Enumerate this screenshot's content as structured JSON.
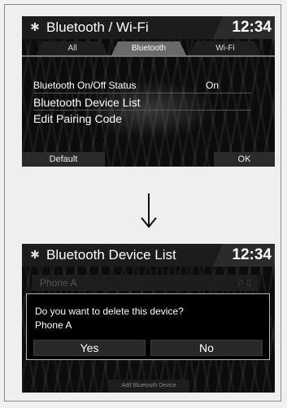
{
  "screen1": {
    "title": "Bluetooth / Wi-Fi",
    "clock": "12:34",
    "title_icon": "settings-gear-icon",
    "tabs": [
      {
        "label": "All",
        "active": false
      },
      {
        "label": "Bluetooth",
        "active": true
      },
      {
        "label": "Wi-Fi",
        "active": false
      }
    ],
    "rows": [
      {
        "label": "Bluetooth On/Off Status",
        "value": "On"
      },
      {
        "label": "Bluetooth Device List",
        "value": ""
      },
      {
        "label": "Edit Pairing Code",
        "value": ""
      }
    ],
    "default_label": "Default",
    "ok_label": "OK"
  },
  "arrow_icon": "arrow-down-icon",
  "screen2": {
    "title": "Bluetooth Device List",
    "clock": "12:34",
    "title_icon": "settings-gear-icon",
    "device_row": "Phone A",
    "device_icons": "music-note-icon, phone-icon",
    "dialog": {
      "message": "Do you want to delete this device?",
      "device": "Phone A",
      "yes_label": "Yes",
      "no_label": "No"
    },
    "add_label": "Add Bluetooth Device"
  },
  "colors": {
    "screen_bg": "#0c0c0c",
    "titlebar_bg": "#1c1c1c",
    "active_tab": "#6a6a6a",
    "dialog_border": "#b5b5b5",
    "page_bg": "#efefef"
  }
}
